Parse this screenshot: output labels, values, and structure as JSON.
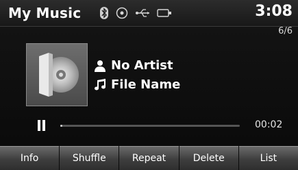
{
  "header": {
    "title": "My Music",
    "clock": "3:08",
    "track_count": "6/6",
    "status_icons": [
      "bluetooth-icon",
      "disc-icon",
      "usb-icon",
      "ipod-icon"
    ]
  },
  "now_playing": {
    "artist": "No Artist",
    "file_name": "File Name",
    "elapsed": "00:02",
    "progress": 0.01,
    "state": "playing"
  },
  "buttons": {
    "info": "Info",
    "shuffle": "Shuffle",
    "repeat": "Repeat",
    "delete": "Delete",
    "list": "List"
  },
  "colors": {
    "background": "#0c0c0c",
    "text": "#ffffff",
    "button": "#4e4e4e"
  }
}
